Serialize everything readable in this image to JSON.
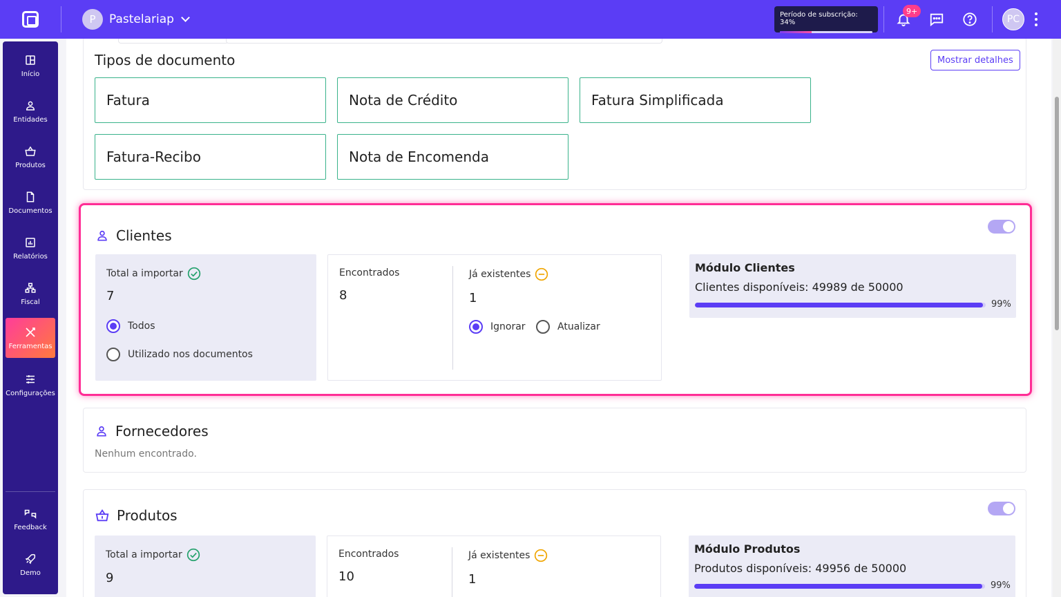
{
  "topbar": {
    "company_initial": "P",
    "company_name": "Pastelariap",
    "subscription_label": "Período de subscrição: 34%",
    "subscription_progress": 0.34,
    "notification_badge": "9+",
    "user_initials": "PC"
  },
  "sidebar": {
    "items": [
      {
        "label": "Início",
        "icon": "grid-icon"
      },
      {
        "label": "Entidades",
        "icon": "user-icon"
      },
      {
        "label": "Produtos",
        "icon": "basket-icon"
      },
      {
        "label": "Documentos",
        "icon": "document-icon"
      },
      {
        "label": "Relatórios",
        "icon": "report-icon"
      },
      {
        "label": "Fiscal",
        "icon": "fiscal-icon"
      },
      {
        "label": "Ferramentas",
        "icon": "tools-icon",
        "active": true
      },
      {
        "label": "Configurações",
        "icon": "sliders-icon"
      }
    ],
    "bottom": [
      {
        "label": "Feedback",
        "icon": "feedback-icon"
      },
      {
        "label": "Demo",
        "icon": "rocket-icon"
      }
    ]
  },
  "doc_types": {
    "title": "Tipos de documento",
    "details_button": "Mostrar detalhes",
    "items": [
      "Fatura",
      "Nota de Crédito",
      "Fatura Simplificada",
      "Fatura-Recibo",
      "Nota de Encomenda"
    ]
  },
  "clientes": {
    "title": "Clientes",
    "total_label": "Total a importar",
    "total_value": "7",
    "options": [
      "Todos",
      "Utilizado nos documentos"
    ],
    "found_label": "Encontrados",
    "found_value": "8",
    "existing_label": "Já existentes",
    "existing_value": "1",
    "existing_options": [
      "Ignorar",
      "Atualizar"
    ],
    "module_title": "Módulo Clientes",
    "module_available": "Clientes disponíveis: 49989 de 50000",
    "module_pct": "99%",
    "module_progress": 0.99
  },
  "fornecedores": {
    "title": "Fornecedores",
    "empty": "Nenhum encontrado."
  },
  "produtos": {
    "title": "Produtos",
    "total_label": "Total a importar",
    "total_value": "9",
    "found_label": "Encontrados",
    "found_value": "10",
    "existing_label": "Já existentes",
    "existing_value": "1",
    "module_title": "Módulo Produtos",
    "module_available": "Produtos disponíveis: 49956 de 50000",
    "module_pct": "99%",
    "module_progress": 0.99
  },
  "colors": {
    "brand": "#5b3df5",
    "sidebar": "#2e1a8a",
    "highlight": "#ff2d95",
    "success": "#22a06b",
    "warning": "#f0a500"
  }
}
